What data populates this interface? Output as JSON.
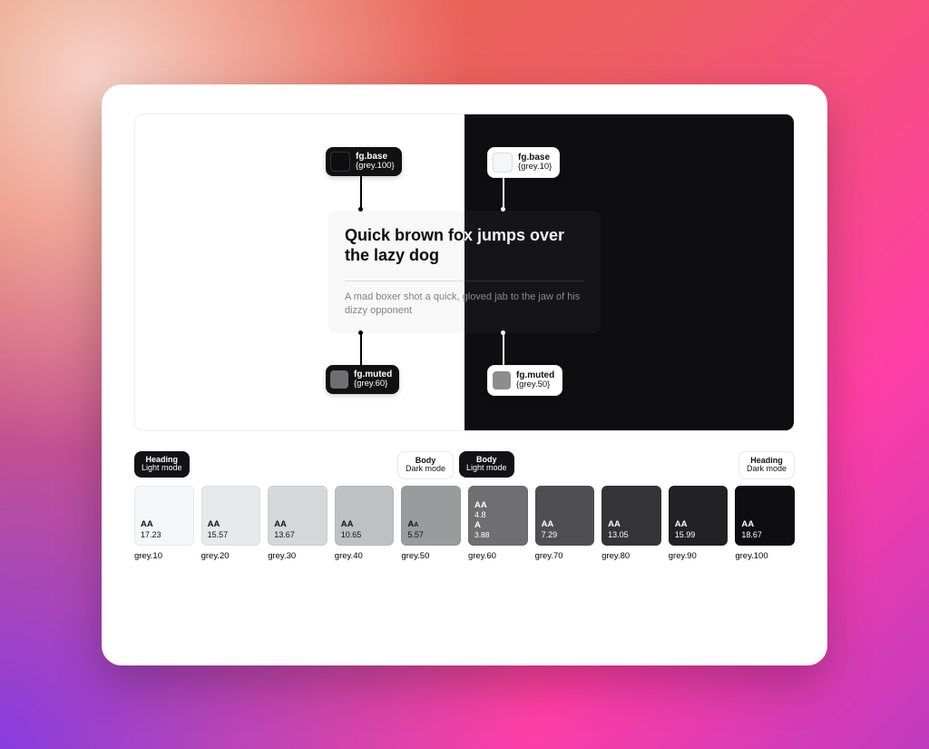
{
  "preview": {
    "heading": "Quick brown fox jumps over the lazy dog",
    "body": "A mad boxer shot a quick, gloved jab to the jaw of his dizzy opponent",
    "tags": {
      "light_heading": {
        "name": "fg.base",
        "ref": "{grey.100}",
        "swatch": "#0e0e10"
      },
      "dark_heading": {
        "name": "fg.base",
        "ref": "{grey.10}",
        "swatch": "#f5f6f7"
      },
      "light_body": {
        "name": "fg.muted",
        "ref": "{grey.60}",
        "swatch": "#6f6f72"
      },
      "dark_body": {
        "name": "fg.muted",
        "ref": "{grey.50}",
        "swatch": "#8d8d90"
      }
    }
  },
  "labels": {
    "heading_light": {
      "l1": "Heading",
      "l2": "Light mode"
    },
    "body_dark": {
      "l1": "Body",
      "l2": "Dark mode"
    },
    "body_light": {
      "l1": "Body",
      "l2": "Light mode"
    },
    "heading_dark": {
      "l1": "Heading",
      "l2": "Dark mode"
    }
  },
  "palette": [
    {
      "name": "grey.10",
      "hex": "#f5f6f7",
      "text": "#111",
      "aa_label": "AA",
      "aa": "17.23"
    },
    {
      "name": "grey.20",
      "hex": "#e8e9ea",
      "text": "#111",
      "aa_label": "AA",
      "aa": "15.57"
    },
    {
      "name": "grey.30",
      "hex": "#d6d7d9",
      "text": "#111",
      "aa_label": "AA",
      "aa": "13.67"
    },
    {
      "name": "grey.40",
      "hex": "#bfc0c2",
      "text": "#111",
      "aa_label": "AA",
      "aa": "10.65"
    },
    {
      "name": "grey.50",
      "hex": "#9a9b9d",
      "text": "#111",
      "aa_label": "AA",
      "aa": "5.57",
      "bigA": true
    },
    {
      "name": "grey.60",
      "hex": "#6f6f72",
      "text": "#fff",
      "aa_label": "AA",
      "aa": "4.8",
      "aa2_label": "A",
      "aa2": "3.88"
    },
    {
      "name": "grey.70",
      "hex": "#4f4f52",
      "text": "#fff",
      "aa_label": "AA",
      "aa": "7.29"
    },
    {
      "name": "grey.80",
      "hex": "#343437",
      "text": "#fff",
      "aa_label": "AA",
      "aa": "13.05"
    },
    {
      "name": "grey.90",
      "hex": "#212124",
      "text": "#fff",
      "aa_label": "AA",
      "aa": "15.99"
    },
    {
      "name": "grey.100",
      "hex": "#0e0e10",
      "text": "#fff",
      "aa_label": "AA",
      "aa": "18.67"
    }
  ]
}
